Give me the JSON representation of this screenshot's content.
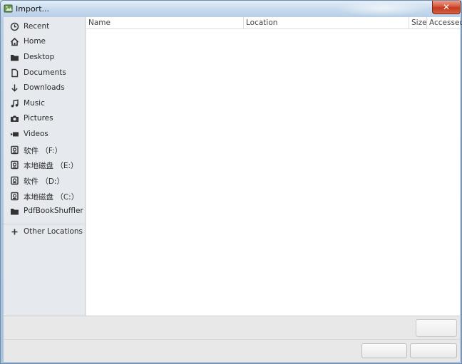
{
  "window": {
    "title": "Import..."
  },
  "titlebar": {
    "close_glyph": "✕"
  },
  "sidebar": {
    "items": [
      {
        "label": "Recent",
        "icon": "clock-icon"
      },
      {
        "label": "Home",
        "icon": "home-icon"
      },
      {
        "label": "Desktop",
        "icon": "folder-icon"
      },
      {
        "label": "Documents",
        "icon": "document-icon"
      },
      {
        "label": "Downloads",
        "icon": "download-arrow-icon"
      },
      {
        "label": "Music",
        "icon": "music-note-icon"
      },
      {
        "label": "Pictures",
        "icon": "camera-icon"
      },
      {
        "label": "Videos",
        "icon": "video-icon"
      },
      {
        "label": "软件 （F:）",
        "icon": "drive-icon"
      },
      {
        "label": "本地磁盘 （E:）",
        "icon": "drive-icon"
      },
      {
        "label": "软件 （D:）",
        "icon": "drive-icon"
      },
      {
        "label": "本地磁盘 （C:）",
        "icon": "drive-icon"
      },
      {
        "label": "PdfBookShuffler",
        "icon": "folder-icon"
      },
      {
        "label": "Other Locations",
        "icon": "plus-icon"
      }
    ]
  },
  "file_list": {
    "columns": [
      "Name",
      "Location",
      "Size",
      "Accessed"
    ],
    "rows": []
  },
  "colors": {
    "frame": "#b8cde4",
    "close_button": "#c23b1e",
    "sidebar_bg": "#e6e9ee"
  }
}
